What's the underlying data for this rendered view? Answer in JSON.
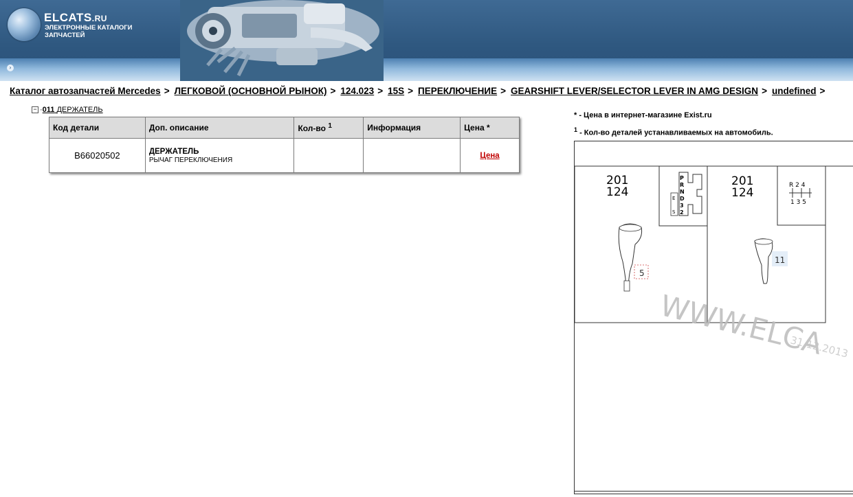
{
  "header": {
    "logo_main": "ELCATS",
    "logo_tld": ".RU",
    "logo_sub": "ЭЛЕКТРОННЫЕ КАТАЛОГИ ЗАПЧАСТЕЙ",
    "globe_icon": "globe-icon",
    "engine_image": "engine-illustration"
  },
  "breadcrumb": [
    "Каталог автозапчастей Mercedes",
    "ЛЕГКОВОЙ (ОСНОВНОЙ РЫНОК)",
    "124.023",
    "15S",
    "ПЕРЕКЛЮЧЕНИЕ",
    "GEARSHIFT LEVER/SELECTOR LEVER IN AMG DESIGN",
    "undefined"
  ],
  "breadcrumb_separator": ">",
  "tree": {
    "collapse_symbol": "−",
    "number": "011",
    "label": "ДЕРЖАТЕЛЬ"
  },
  "table": {
    "headers": {
      "code": "Код детали",
      "description": "Доп. описание",
      "qty": "Кол-во",
      "qty_sup": "1",
      "info": "Информация",
      "price": "Цена *"
    },
    "rows": [
      {
        "code": "B66020502",
        "name": "ДЕРЖАТЕЛЬ",
        "subname": "РЫЧАГ ПЕРЕКЛЮЧЕНИЯ",
        "qty": "",
        "info": "",
        "price_link": "Цена"
      }
    ]
  },
  "notes": {
    "price_note": "* - Цена в интернет-магазине Exist.ru",
    "qty_sup": "1",
    "qty_note": " - Кол-во деталей устанавливаемых на автомобиль."
  },
  "diagram": {
    "left_model_1": "201",
    "left_model_2": "124",
    "right_model_1": "201",
    "right_model_2": "124",
    "auto_gate": [
      "P",
      "R",
      "N",
      "D",
      "3",
      "2"
    ],
    "auto_gate_small": [
      "E",
      "S"
    ],
    "manual_top": "R 2 4",
    "manual_bottom": "1 3 5",
    "callout_left": "5",
    "callout_right": "11",
    "watermark": "WWW.ELCA",
    "watermark_date": "31.12.2013"
  },
  "colors": {
    "header_dark": "#2f5880",
    "price_link": "#c00000",
    "table_header_bg": "#dcdcdc"
  }
}
